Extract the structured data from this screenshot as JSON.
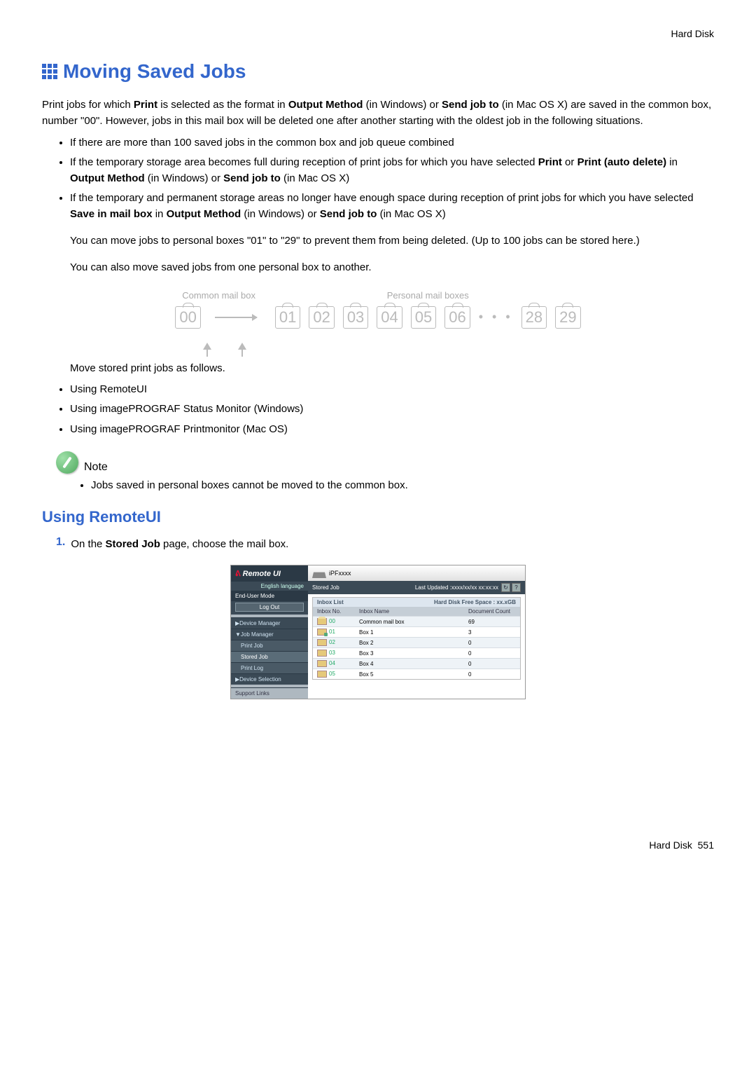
{
  "header": {
    "right": "Hard Disk"
  },
  "title": "Moving Saved Jobs",
  "intro": {
    "p1a": "Print jobs for which ",
    "p1b": "Print",
    "p1c": " is selected as the format in ",
    "p1d": "Output Method",
    "p1e": " (in Windows) or ",
    "p1f": "Send job to",
    "p1g": " (in Mac OS X) are saved in the common box, number \"00\". However, jobs in this mail box will be deleted one after another starting with the oldest job in the following situations."
  },
  "conditions": {
    "b1": "If there are more than 100 saved jobs in the common box and job queue combined",
    "b2a": "If the temporary storage area becomes full during reception of print jobs for which you have selected ",
    "b2b": "Print",
    "b2c": " or ",
    "b2d": "Print (auto delete)",
    "b2e": " in ",
    "b2f": "Output Method",
    "b2g": " (in Windows) or ",
    "b2h": "Send job to",
    "b2i": " (in Mac OS X)",
    "b3a": "If the temporary and permanent storage areas no longer have enough space during reception of print jobs for which you have selected ",
    "b3b": "Save in mail box",
    "b3c": " in ",
    "b3d": "Output Method",
    "b3e": " (in Windows) or ",
    "b3f": "Send job to",
    "b3g": " (in Mac OS X)"
  },
  "after": {
    "l1": "You can move jobs to personal boxes \"01\" to \"29\" to prevent them from being deleted. (Up to 100 jobs can be stored here.)",
    "l2": "You can also move saved jobs from one personal box to another."
  },
  "diagram": {
    "common_label": "Common mail box",
    "personal_label": "Personal mail boxes",
    "boxes": [
      "00",
      "01",
      "02",
      "03",
      "04",
      "05",
      "06",
      "28",
      "29"
    ],
    "ellipsis": "• • •"
  },
  "move_intro": "Move stored print jobs as follows.",
  "methods": {
    "m1": "Using RemoteUI",
    "m2": "Using imagePROGRAF Status Monitor (Windows)",
    "m3": "Using imagePROGRAF Printmonitor (Mac OS)"
  },
  "note": {
    "label": "Note",
    "text": "Jobs saved in personal boxes cannot be moved to the common box."
  },
  "subsection": "Using RemoteUI",
  "step1": {
    "num": "1.",
    "a": "On the ",
    "b": "Stored Job",
    "c": " page, choose the mail box."
  },
  "remoteui": {
    "logo": "Remote UI",
    "lang": "English language",
    "mode": "End-User Mode",
    "logout": "Log Out",
    "nav": {
      "dm": "▶Device Manager",
      "jm": "▼Job Manager",
      "pj": "Print Job",
      "sj": "Stored Job",
      "pl": "Print Log",
      "ds": "▶Device Selection",
      "sl": "Support Links"
    },
    "model": "iPFxxxx",
    "bar_title": "Stored Job",
    "bar_right": "Last Updated :xxxx/xx/xx xx:xx:xx",
    "panel_title": "Inbox List",
    "panel_right": "Hard Disk Free Space : xx.xGB",
    "cols": {
      "no": "Inbox No.",
      "name": "Inbox Name",
      "count": "Document Count"
    },
    "rows": [
      {
        "no": "00",
        "name": "Common mail box",
        "count": "69",
        "open": true,
        "lock": false
      },
      {
        "no": "01",
        "name": "Box 1",
        "count": "3",
        "open": false,
        "lock": true
      },
      {
        "no": "02",
        "name": "Box 2",
        "count": "0",
        "open": false,
        "lock": false
      },
      {
        "no": "03",
        "name": "Box 3",
        "count": "0",
        "open": false,
        "lock": false
      },
      {
        "no": "04",
        "name": "Box 4",
        "count": "0",
        "open": false,
        "lock": false
      },
      {
        "no": "05",
        "name": "Box 5",
        "count": "0",
        "open": false,
        "lock": false
      }
    ]
  },
  "footer": {
    "left": "Hard Disk",
    "page": "551"
  }
}
